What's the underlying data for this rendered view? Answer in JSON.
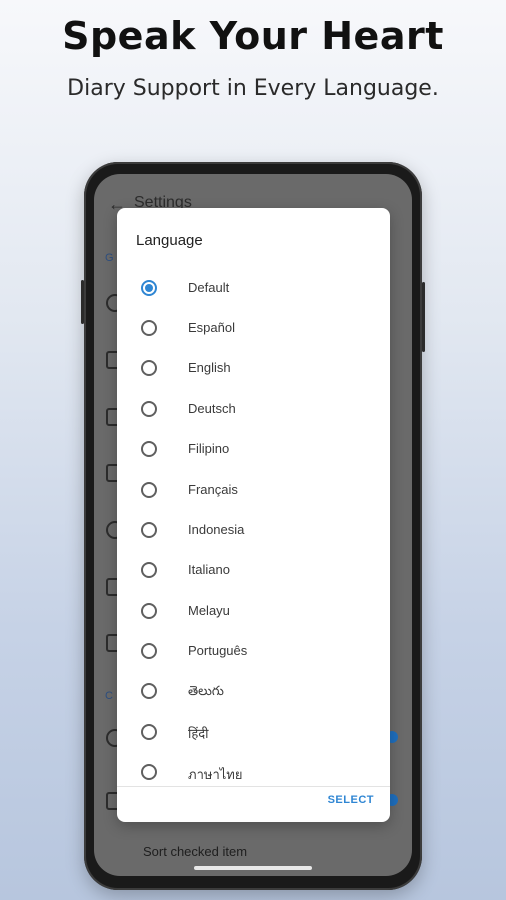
{
  "promo": {
    "headline": "Speak Your Heart",
    "subheadline": "Diary Support in Every Language."
  },
  "settings_screen": {
    "title": "Settings",
    "bottom_item": "Sort checked item"
  },
  "dialog": {
    "title": "Language",
    "selected": "Default",
    "options": [
      "Default",
      "Español",
      "English",
      "Deutsch",
      "Filipino",
      "Français",
      "Indonesia",
      "Italiano",
      "Melayu",
      "Português",
      "తెలుగు",
      "हिंदी",
      "ภาษาไทย"
    ],
    "select_label": "SELECT"
  },
  "colors": {
    "accent": "#2f86d3",
    "scrim": "#6a6a6a"
  }
}
